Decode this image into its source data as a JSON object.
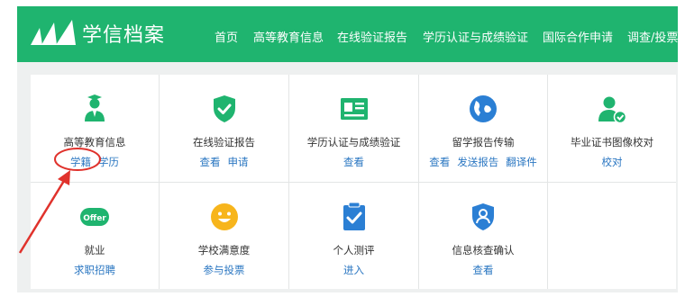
{
  "header": {
    "brand": "学信档案",
    "nav": [
      "首页",
      "高等教育信息",
      "在线验证报告",
      "学历认证与成绩验证",
      "国际合作申请",
      "调查/投票"
    ]
  },
  "services": [
    {
      "title": "高等教育信息",
      "links": [
        "学籍",
        "学历"
      ],
      "icon": "graduate-icon"
    },
    {
      "title": "在线验证报告",
      "links": [
        "查看",
        "申请"
      ],
      "icon": "shield-check-icon"
    },
    {
      "title": "学历认证与成绩验证",
      "links": [
        "查看"
      ],
      "icon": "id-card-icon"
    },
    {
      "title": "留学报告传输",
      "links": [
        "查看",
        "发送报告",
        "翻译件"
      ],
      "icon": "globe-icon"
    },
    {
      "title": "毕业证书图像校对",
      "links": [
        "校对"
      ],
      "icon": "user-verified-icon"
    },
    {
      "title": "就业",
      "links": [
        "求职招聘"
      ],
      "icon": "offer-icon",
      "icon_text": "Offer"
    },
    {
      "title": "学校满意度",
      "links": [
        "参与投票"
      ],
      "icon": "smile-icon"
    },
    {
      "title": "个人测评",
      "links": [
        "进入"
      ],
      "icon": "clipboard-check-icon"
    },
    {
      "title": "信息核查确认",
      "links": [
        "查看"
      ],
      "icon": "person-shield-icon"
    }
  ],
  "colors": {
    "brand_green": "#1fb46f",
    "link_blue": "#2b77c2",
    "annotation_red": "#e0322c"
  }
}
